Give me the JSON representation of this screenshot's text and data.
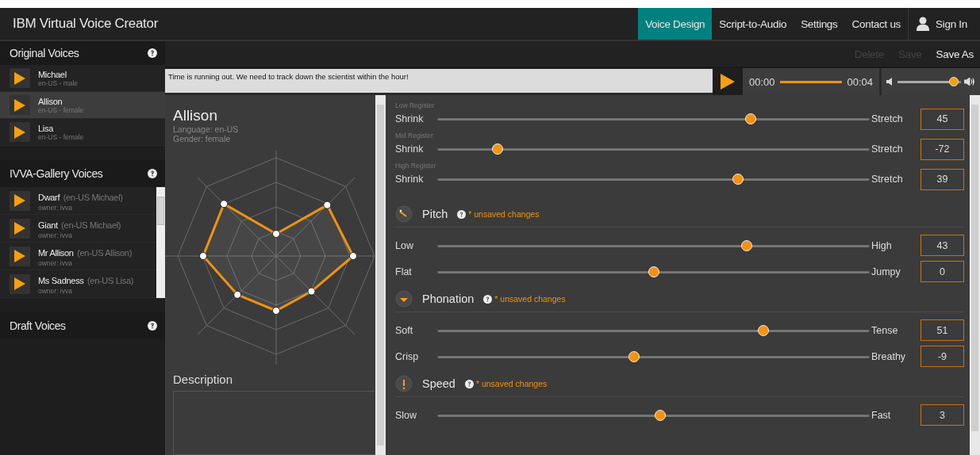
{
  "app_title": "IBM Virtual Voice Creator",
  "nav": [
    {
      "label": "Voice Design",
      "kind": "link",
      "selected": true
    },
    {
      "label": "Script-to-Audio",
      "kind": "link",
      "selected": false
    },
    {
      "label": "Settings",
      "kind": "link",
      "selected": false
    },
    {
      "label": "Contact us",
      "kind": "link",
      "selected": false
    },
    {
      "label": "Sign In",
      "kind": "account",
      "selected": false
    }
  ],
  "sidebar": [
    {
      "title": "Original Voices",
      "kind": "original",
      "voices": [
        {
          "name": "Michael",
          "detail": "en-US - male",
          "selected": false
        },
        {
          "name": "Allison",
          "detail": "en-US - female",
          "selected": true
        },
        {
          "name": "Lisa",
          "detail": "en-US - female",
          "selected": false
        }
      ]
    },
    {
      "title": "IVVA-Gallery Voices",
      "kind": "gallery",
      "voices": [
        {
          "name": "Dwarf",
          "base": "(en-US Michael)",
          "detail": "owner: ivva",
          "selected": false
        },
        {
          "name": "Giant",
          "base": "(en-US Michael)",
          "detail": "owner: ivva",
          "selected": false
        },
        {
          "name": "Mr Allison",
          "base": "(en-US Allison)",
          "detail": "owner: ivva",
          "selected": false
        },
        {
          "name": "Ms Sadness",
          "base": "(en-US Lisa)",
          "detail": "owner: ivva",
          "selected": false
        }
      ]
    },
    {
      "title": "Draft Voices",
      "kind": "draft"
    }
  ],
  "toolbar": [
    {
      "label": "Delete",
      "disabled": true
    },
    {
      "label": "Save",
      "disabled": true
    },
    {
      "label": "Save As",
      "disabled": false
    }
  ],
  "player": {
    "script": "Time is running out. We need to track down the scientist within the hour!",
    "time_start": "00:00",
    "time_end": "00:04",
    "level": 1,
    "volume": {
      "level": 0.9
    }
  },
  "voice": {
    "name": "Allison",
    "language": "Language: en-US",
    "gender": "Gender: female",
    "description_label": "Description"
  },
  "groups": [
    {
      "kind": "register",
      "sliders": [
        {
          "caption": "Low Register",
          "low": "Shrink",
          "high": "Stretch",
          "value": "45",
          "level": 0.725
        },
        {
          "caption": "Mid Register",
          "low": "Shrink",
          "high": "Stretch",
          "value": "-72",
          "level": 0.14
        },
        {
          "caption": "High Register",
          "low": "Shrink",
          "high": "Stretch",
          "value": "39",
          "level": 0.695
        }
      ]
    },
    {
      "kind": "pitch",
      "title": "Pitch",
      "status": "* unsaved changes",
      "sliders": [
        {
          "low": "Low",
          "high": "High",
          "value": "43",
          "level": 0.715
        },
        {
          "low": "Flat",
          "high": "Jumpy",
          "value": "0",
          "level": 0.5
        }
      ]
    },
    {
      "kind": "phonation",
      "title": "Phonation",
      "status": "* unsaved changes",
      "sliders": [
        {
          "low": "Soft",
          "high": "Tense",
          "value": "51",
          "level": 0.755
        },
        {
          "low": "Crisp",
          "high": "Breathy",
          "value": "-9",
          "level": 0.455
        }
      ]
    },
    {
      "kind": "speed",
      "title": "Speed",
      "status": "* unsaved changes",
      "sliders": [
        {
          "low": "Slow",
          "high": "Fast",
          "value": "3",
          "level": 0.515
        }
      ]
    }
  ]
}
